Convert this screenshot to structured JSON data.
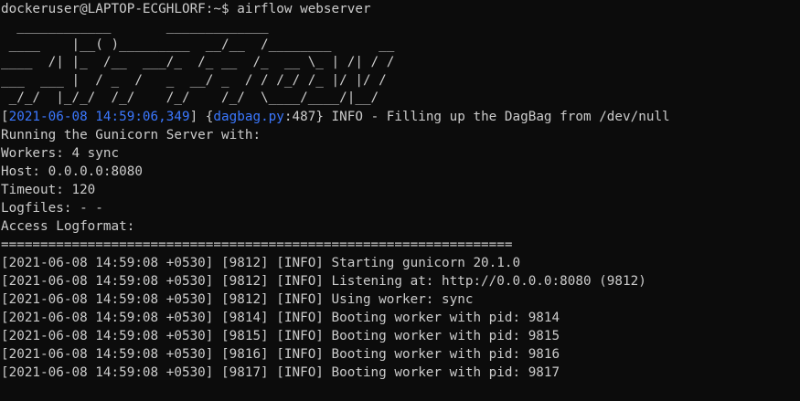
{
  "prompt": {
    "user_host": "dockeruser@LAPTOP-ECGHLORF",
    "separator": ":",
    "path": "~",
    "symbol": "$",
    "command": "airflow webserver"
  },
  "ascii_art": [
    "  ____________       _____________",
    " ____    |__( )_________  __/__  /________      __",
    "____  /| |_  /__  ___/_  /_ __  /_  __ \\_ | /| / /",
    "___  ___ |  / _  /   _  __/ _  / / /_/ /_ |/ |/ /",
    " _/_/  |_/_/  /_/    /_/    /_/  \\____/____/|__/"
  ],
  "dagbag_line": {
    "open_bracket": "[",
    "timestamp": "2021-06-08 14:59:06,349",
    "close_bracket": "]",
    "open_brace": " {",
    "source_file": "dagbag.py",
    "line_suffix": ":487} INFO - Filling up the DagBag from /dev/null"
  },
  "gunicorn_info": [
    "Running the Gunicorn Server with:",
    "Workers: 4 sync",
    "Host: 0.0.0.0:8080",
    "Timeout: 120",
    "Logfiles: - -",
    "Access Logformat:"
  ],
  "separator_line": "=================================================================",
  "log_lines": [
    "[2021-06-08 14:59:08 +0530] [9812] [INFO] Starting gunicorn 20.1.0",
    "[2021-06-08 14:59:08 +0530] [9812] [INFO] Listening at: http://0.0.0.0:8080 (9812)",
    "[2021-06-08 14:59:08 +0530] [9812] [INFO] Using worker: sync",
    "[2021-06-08 14:59:08 +0530] [9814] [INFO] Booting worker with pid: 9814",
    "[2021-06-08 14:59:08 +0530] [9815] [INFO] Booting worker with pid: 9815",
    "[2021-06-08 14:59:08 +0530] [9816] [INFO] Booting worker with pid: 9816",
    "[2021-06-08 14:59:08 +0530] [9817] [INFO] Booting worker with pid: 9817"
  ],
  "colors": {
    "background": "#0c0c0c",
    "foreground": "#cccccc",
    "highlight": "#3b78ff"
  }
}
